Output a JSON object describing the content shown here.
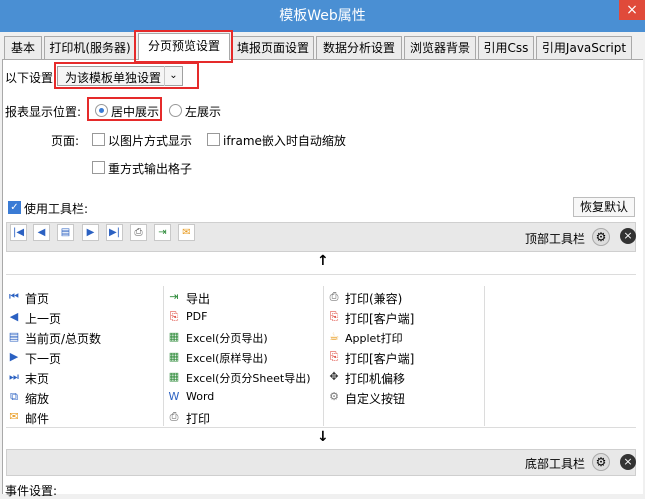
{
  "window": {
    "title": "模板Web属性",
    "close": "×"
  },
  "tabs": [
    "基本",
    "打印机(服务器)",
    "分页预览设置",
    "填报页面设置",
    "数据分析设置",
    "浏览器背景",
    "引用Css",
    "引用JavaScript"
  ],
  "settings": {
    "scope_label": "以下设置",
    "scope_value": "为该模板单独设置",
    "position_label": "报表显示位置:",
    "center": "居中展示",
    "left": "左展示",
    "page_label": "页面:",
    "opt_image": "以图片方式显示",
    "opt_iframe": "iframe嵌入时自动缩放",
    "opt_reprint": "重方式输出格子"
  },
  "toolbar": {
    "use_label": "使用工具栏:",
    "restore": "恢复默认",
    "top_label": "顶部工具栏",
    "bottom_label": "底部工具栏",
    "up_arrow": "↑",
    "down_arrow": "↓"
  },
  "buttons": {
    "col1": [
      "首页",
      "上一页",
      "当前页/总页数",
      "下一页",
      "末页",
      "缩放",
      "邮件"
    ],
    "col2": [
      "导出",
      "PDF",
      "Excel(分页导出)",
      "Excel(原样导出)",
      "Excel(分页分Sheet导出)",
      "Word",
      "打印"
    ],
    "col3": [
      "打印(兼容)",
      "打印[客户端]",
      "Applet打印",
      "打印[客户端]",
      "打印机偏移",
      "自定义按钮"
    ]
  },
  "footer": {
    "event_label": "事件设置:"
  },
  "colors": {
    "titlebar": "#4a8fd3",
    "accent": "#3a7bd5",
    "highlight": "#e52a2a"
  }
}
